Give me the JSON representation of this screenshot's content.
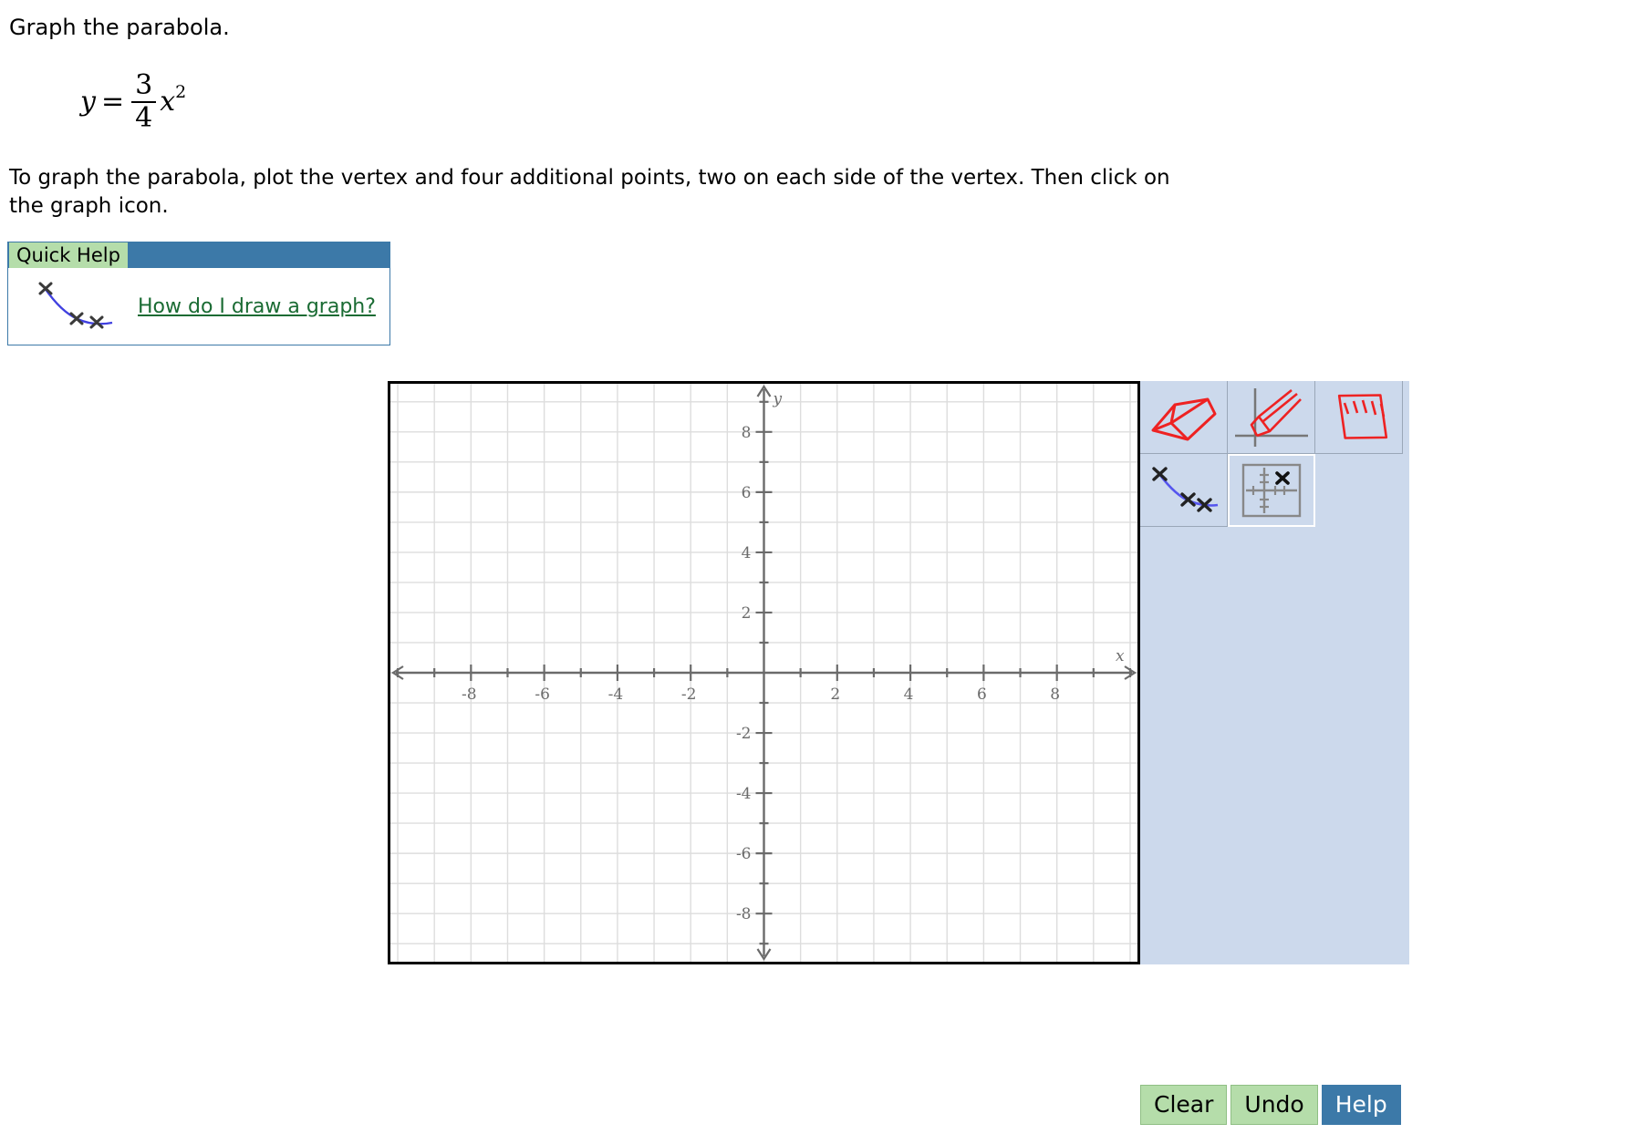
{
  "prompt": "Graph the parabola.",
  "equation": {
    "lhs": "y",
    "equals": "=",
    "numerator": "3",
    "denominator": "4",
    "variable": "x",
    "exponent": "2",
    "plain": "y = 3/4 x^2"
  },
  "instructions": "To graph the parabola, plot the vertex and four additional points, two on each side of the vertex. Then click on the graph icon.",
  "quick_help": {
    "tab_label": "Quick Help",
    "link_label": "How do I draw a graph?",
    "icon": "graph-curve-icon",
    "tab_color": "#b5ddaa",
    "header_color": "#3c79a8",
    "link_color": "#1a6b33"
  },
  "graph": {
    "x_axis_label": "x",
    "y_axis_label": "y",
    "x_tick_labels": [
      "-8",
      "-6",
      "-4",
      "-2",
      "2",
      "4",
      "6",
      "8"
    ],
    "y_tick_labels": [
      "8",
      "6",
      "4",
      "2",
      "-2",
      "-4",
      "-6",
      "-8"
    ],
    "xlim": [
      -10.2,
      10.2
    ],
    "ylim": [
      -9.6,
      9.6
    ],
    "grid": true,
    "grid_color": "#dddddd",
    "axis_color": "#6b6b6b",
    "border_color": "#000000"
  },
  "toolbar": {
    "background": "#ccd9ec",
    "tools": [
      {
        "name": "eraser-tool",
        "icon": "eraser-icon",
        "selected": false
      },
      {
        "name": "plot-point-tool",
        "icon": "pencil-icon",
        "selected": false
      },
      {
        "name": "draw-line-tool",
        "icon": "ruler-icon",
        "selected": false
      },
      {
        "name": "draw-graph-tool",
        "icon": "graph-curve-icon",
        "selected": false
      },
      {
        "name": "plot-point-grid-tool",
        "icon": "point-on-grid-icon",
        "selected": true
      }
    ]
  },
  "buttons": {
    "clear": "Clear",
    "undo": "Undo",
    "help": "Help"
  },
  "chart_data": {
    "type": "line",
    "title": "",
    "xlabel": "x",
    "ylabel": "y",
    "xlim": [
      -10.2,
      10.2
    ],
    "ylim": [
      -9.6,
      9.6
    ],
    "xticks": [
      -8,
      -6,
      -4,
      -2,
      2,
      4,
      6,
      8
    ],
    "yticks": [
      8,
      6,
      4,
      2,
      -2,
      -4,
      -6,
      -8
    ],
    "grid": true,
    "legend": null,
    "series": [
      {
        "name": "y = 3/4 x^2",
        "x": [],
        "y": [],
        "plotted": false
      }
    ]
  }
}
